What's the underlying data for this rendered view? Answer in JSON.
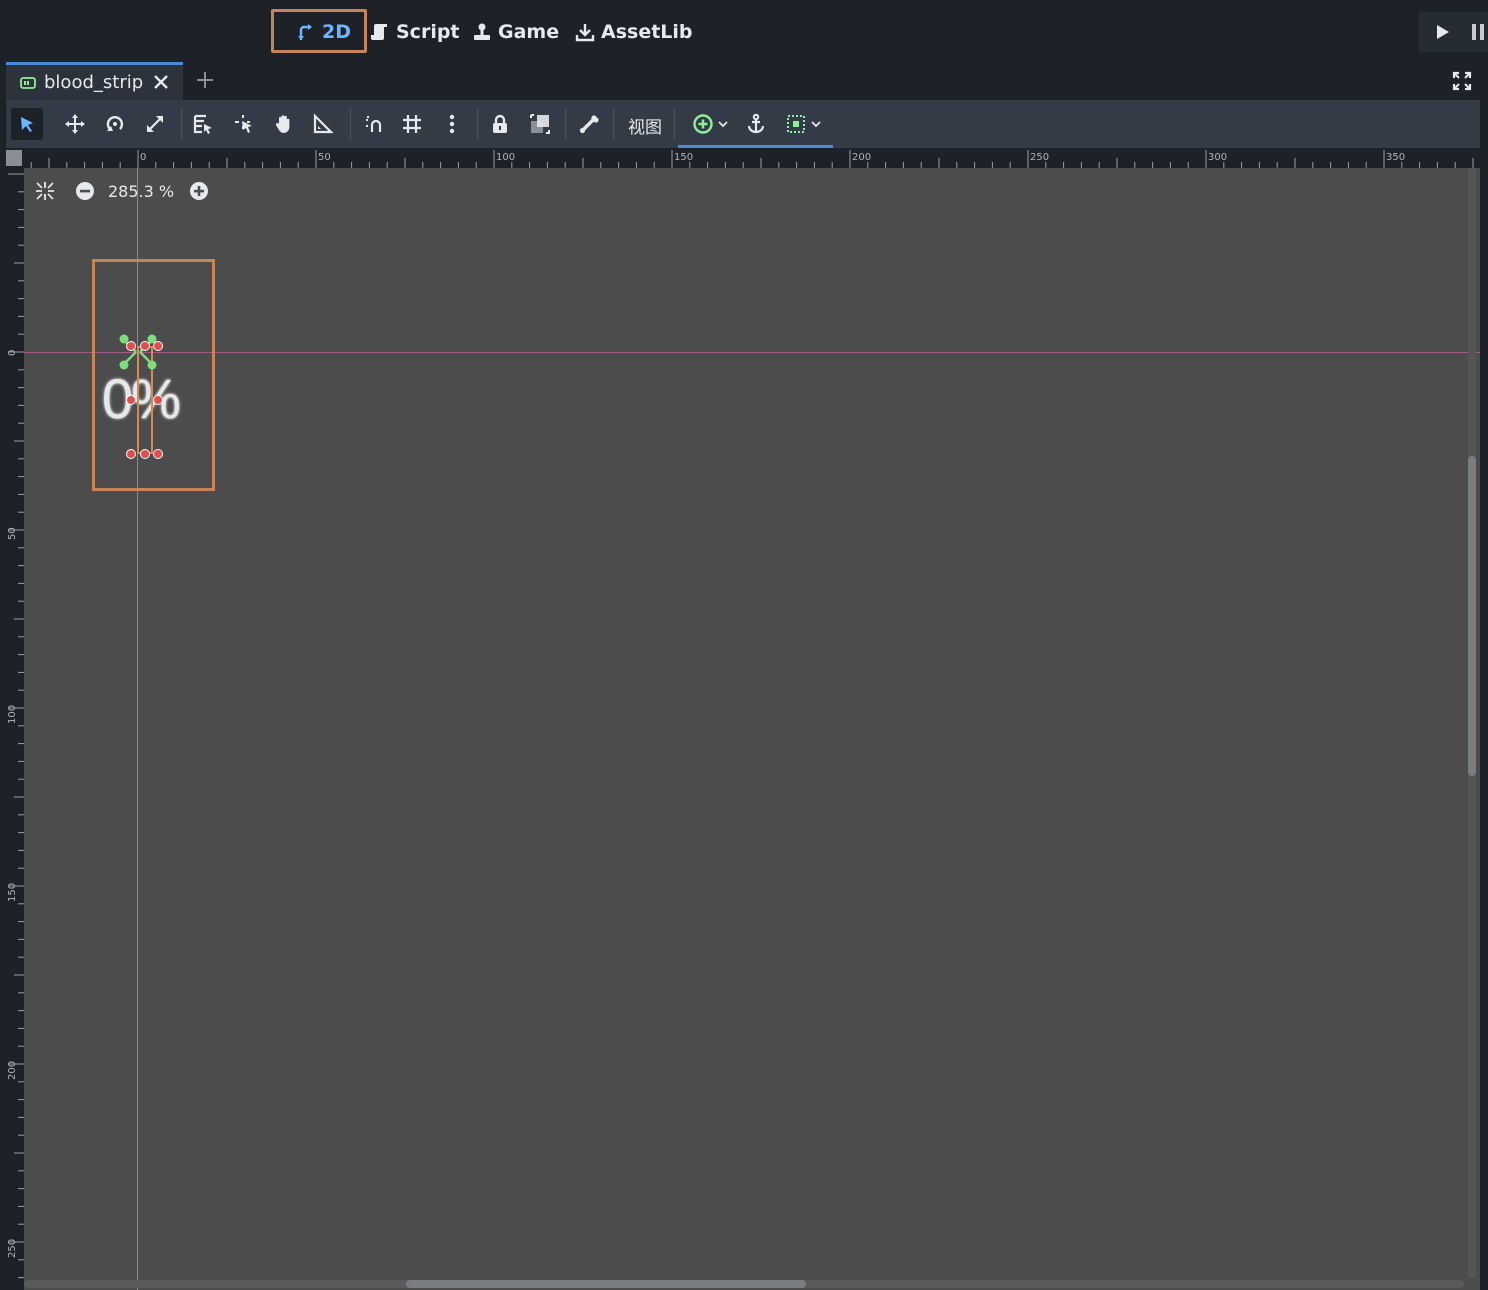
{
  "main_tabs": [
    {
      "label": "2D",
      "icon": "2d-transform-icon",
      "active": true
    },
    {
      "label": "Script",
      "icon": "script-icon",
      "active": false
    },
    {
      "label": "Game",
      "icon": "game-joystick-icon",
      "active": false
    },
    {
      "label": "AssetLib",
      "icon": "download-icon",
      "active": false
    }
  ],
  "scene_tabs": [
    {
      "label": "blood_strip",
      "icon": "control-node-icon"
    }
  ],
  "toolbar": {
    "view_menu_label": "视图"
  },
  "viewport": {
    "zoom_level": "285.3 %",
    "node_text": "0%"
  },
  "rulers": {
    "top_labels": [
      "0",
      "50",
      "100",
      "150",
      "200",
      "250",
      "300",
      "350"
    ],
    "left_labels": [
      "0",
      "50",
      "100",
      "150",
      "200",
      "250"
    ]
  },
  "colors": {
    "accent": "#4c8bd8",
    "active_tab_text": "#6cb6ff",
    "selection_highlight": "#c78457",
    "viewport_bg": "#4c4c4c",
    "handle_red": "#e44d4d",
    "handle_green": "#7fdc7f"
  }
}
